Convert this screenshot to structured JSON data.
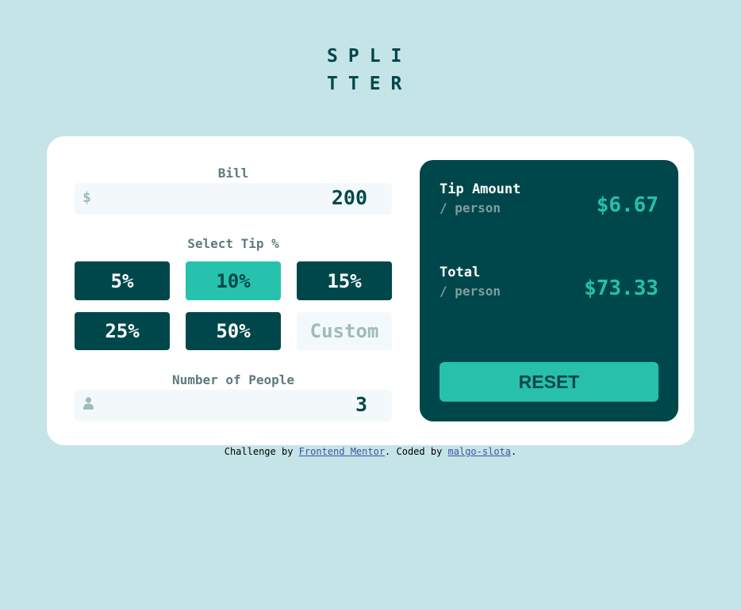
{
  "logo": {
    "line1": "SPLI",
    "line2": "TTER"
  },
  "bill": {
    "label": "Bill",
    "currency_icon": "dollar-icon",
    "currency_symbol": "$",
    "value": "200"
  },
  "tip": {
    "label": "Select Tip %",
    "options": [
      "5%",
      "10%",
      "15%",
      "25%",
      "50%"
    ],
    "selected": "10%",
    "custom_placeholder": "Custom"
  },
  "people": {
    "label": "Number of People",
    "icon": "person-icon",
    "value": "3"
  },
  "results": {
    "tip_amount": {
      "title": "Tip Amount",
      "sub": "/ person",
      "value": "$6.67"
    },
    "total": {
      "title": "Total",
      "sub": "/ person",
      "value": "$73.33"
    },
    "reset_label": "RESET"
  },
  "footer": {
    "prefix": "Challenge by",
    "link1": "Frontend Mentor",
    "middle": ". Coded by",
    "link2": "malgo-slota",
    "suffix": "."
  },
  "colors": {
    "background": "#c5e4e7",
    "dark_cyan": "#00474b",
    "strong_cyan": "#26c2ad",
    "input_bg": "#f3f9fa"
  }
}
